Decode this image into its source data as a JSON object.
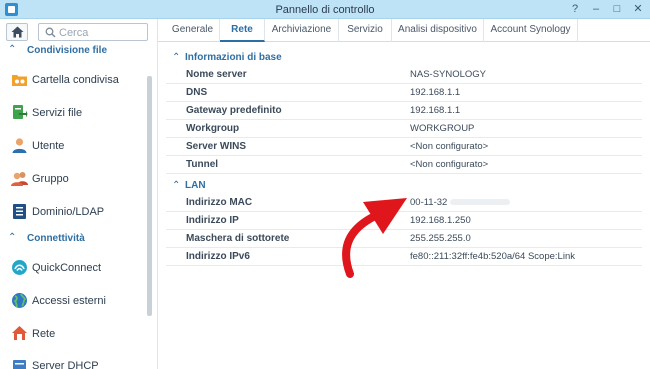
{
  "window": {
    "title": "Pannello di controllo",
    "controls": [
      "?",
      "–",
      "□",
      "✕"
    ]
  },
  "sidebar": {
    "search_placeholder": "Cerca",
    "sections": [
      {
        "label": "Condivisione file",
        "items": [
          {
            "label": "Cartella condivisa",
            "icon": "shared-folder-icon"
          },
          {
            "label": "Servizi file",
            "icon": "file-services-icon"
          },
          {
            "label": "Utente",
            "icon": "user-icon"
          },
          {
            "label": "Gruppo",
            "icon": "group-icon"
          },
          {
            "label": "Dominio/LDAP",
            "icon": "domain-ldap-icon"
          }
        ]
      },
      {
        "label": "Connettività",
        "items": [
          {
            "label": "QuickConnect",
            "icon": "quickconnect-icon"
          },
          {
            "label": "Accessi esterni",
            "icon": "globe-icon"
          },
          {
            "label": "Rete",
            "icon": "network-icon"
          },
          {
            "label": "Server DHCP",
            "icon": "dhcp-icon"
          }
        ]
      }
    ]
  },
  "tabs": [
    {
      "label": "Generale"
    },
    {
      "label": "Rete",
      "active": true
    },
    {
      "label": "Archiviazione"
    },
    {
      "label": "Servizio"
    },
    {
      "label": "Analisi dispositivo"
    },
    {
      "label": "Account Synology"
    }
  ],
  "groups": [
    {
      "label": "Informazioni di base",
      "rows": [
        {
          "key": "Nome server",
          "value": "NAS-SYNOLOGY"
        },
        {
          "key": "DNS",
          "value": "192.168.1.1"
        },
        {
          "key": "Gateway predefinito",
          "value": "192.168.1.1"
        },
        {
          "key": "Workgroup",
          "value": "WORKGROUP"
        },
        {
          "key": "Server WINS",
          "value": "<Non configurato>"
        },
        {
          "key": "Tunnel",
          "value": "<Non configurato>"
        }
      ]
    },
    {
      "label": "LAN",
      "rows": [
        {
          "key": "Indirizzo MAC",
          "value": "00-11-32"
        },
        {
          "key": "Indirizzo IP",
          "value": "192.168.1.250"
        },
        {
          "key": "Maschera di sottorete",
          "value": "255.255.255.0"
        },
        {
          "key": "Indirizzo IPv6",
          "value": "fe80::211:32ff:fe4b:520a/64 Scope:Link"
        }
      ]
    }
  ],
  "colors": {
    "titlebar": "#bfe3f6",
    "accent": "#2f6fa3",
    "annotation_arrow": "#e0161d"
  }
}
